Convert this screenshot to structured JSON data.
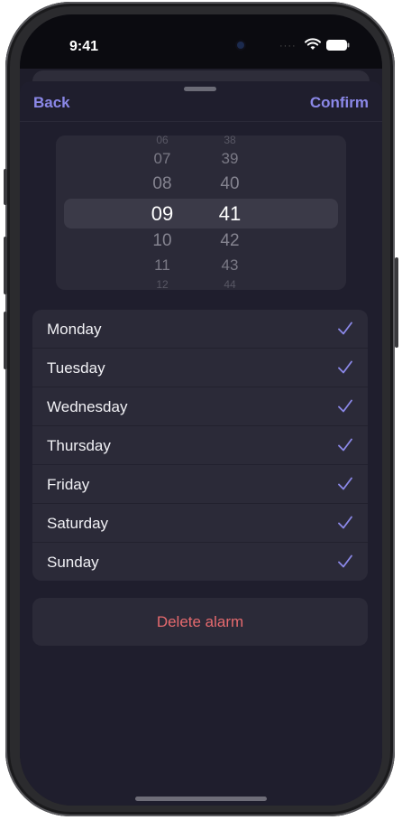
{
  "status_bar": {
    "time": "9:41"
  },
  "nav": {
    "back_label": "Back",
    "confirm_label": "Confirm"
  },
  "picker": {
    "hours": [
      "06",
      "07",
      "08",
      "09",
      "10",
      "11",
      "12"
    ],
    "minutes": [
      "38",
      "39",
      "40",
      "41",
      "42",
      "43",
      "44"
    ],
    "selected_hour": "09",
    "selected_minute": "41"
  },
  "days": [
    {
      "label": "Monday",
      "checked": true
    },
    {
      "label": "Tuesday",
      "checked": true
    },
    {
      "label": "Wednesday",
      "checked": true
    },
    {
      "label": "Thursday",
      "checked": true
    },
    {
      "label": "Friday",
      "checked": true
    },
    {
      "label": "Saturday",
      "checked": true
    },
    {
      "label": "Sunday",
      "checked": true
    }
  ],
  "delete_label": "Delete alarm",
  "colors": {
    "accent": "#8b88e8",
    "destructive": "#e66a6e",
    "background": "#1f1e2d"
  }
}
